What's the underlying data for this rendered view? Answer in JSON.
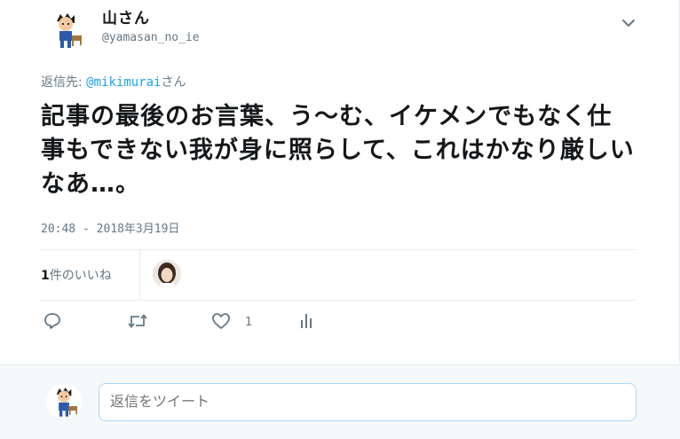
{
  "user": {
    "display_name": "山さん",
    "screen_name": "@yamasan_no_ie"
  },
  "reply_to": {
    "prefix": "返信先: ",
    "handle": "@mikimurai",
    "suffix": "さん"
  },
  "tweet": {
    "text": "記事の最後のお言葉、う～む、イケメンでもなく仕事もできない我が身に照らして、これはかなり厳しいなあ…。",
    "timestamp": "20:48 - 2018年3月19日"
  },
  "stats": {
    "likes_number": "1",
    "likes_label": "件のいいね"
  },
  "actions": {
    "reply_icon": "reply-icon",
    "retweet_icon": "retweet-icon",
    "like_icon": "heart-icon",
    "like_count": "1",
    "analytics_icon": "analytics-icon"
  },
  "reply_box": {
    "placeholder": "返信をツイート"
  },
  "colors": {
    "link": "#1da1f2",
    "secondary_text": "#657786",
    "primary_text": "#14171a",
    "border": "#e6ecf0",
    "reply_bar_bg": "#f5f8fa",
    "input_border": "#a4d9f9"
  }
}
